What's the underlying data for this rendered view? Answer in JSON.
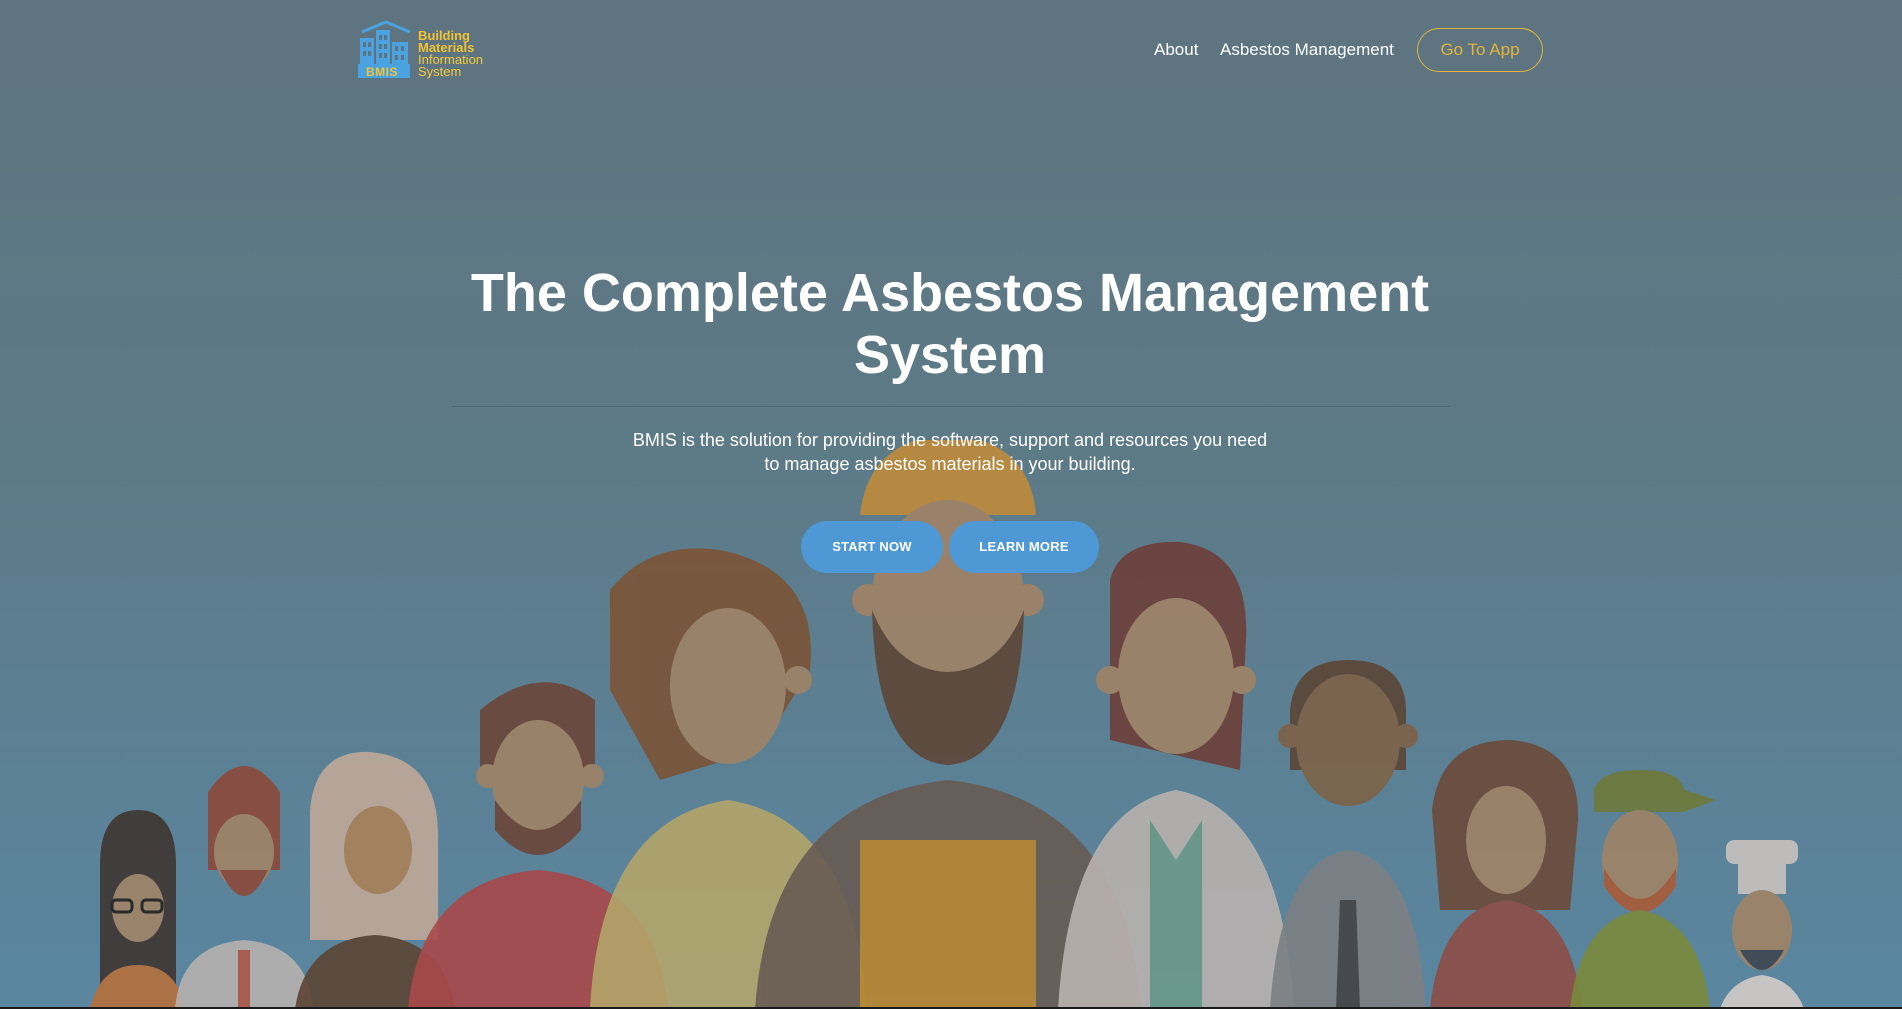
{
  "brand": {
    "logo_abbr": "BMIS",
    "line1": "Building",
    "line2": "Materials",
    "line3": "Information",
    "line4": "System"
  },
  "nav": {
    "about": "About",
    "asbestos": "Asbestos Management",
    "go_app": "Go To App"
  },
  "hero": {
    "title": "The Complete Asbestos Management System",
    "subtitle_line1": "BMIS is the solution for providing the software, support and resources you need",
    "subtitle_line2": "to manage asbestos materials in your building.",
    "start_now": "START NOW",
    "learn_more": "LEARN MORE"
  },
  "colors": {
    "accent": "#e3b33a",
    "button": "#4f98d6",
    "logo_blue": "#4aa3e0"
  }
}
